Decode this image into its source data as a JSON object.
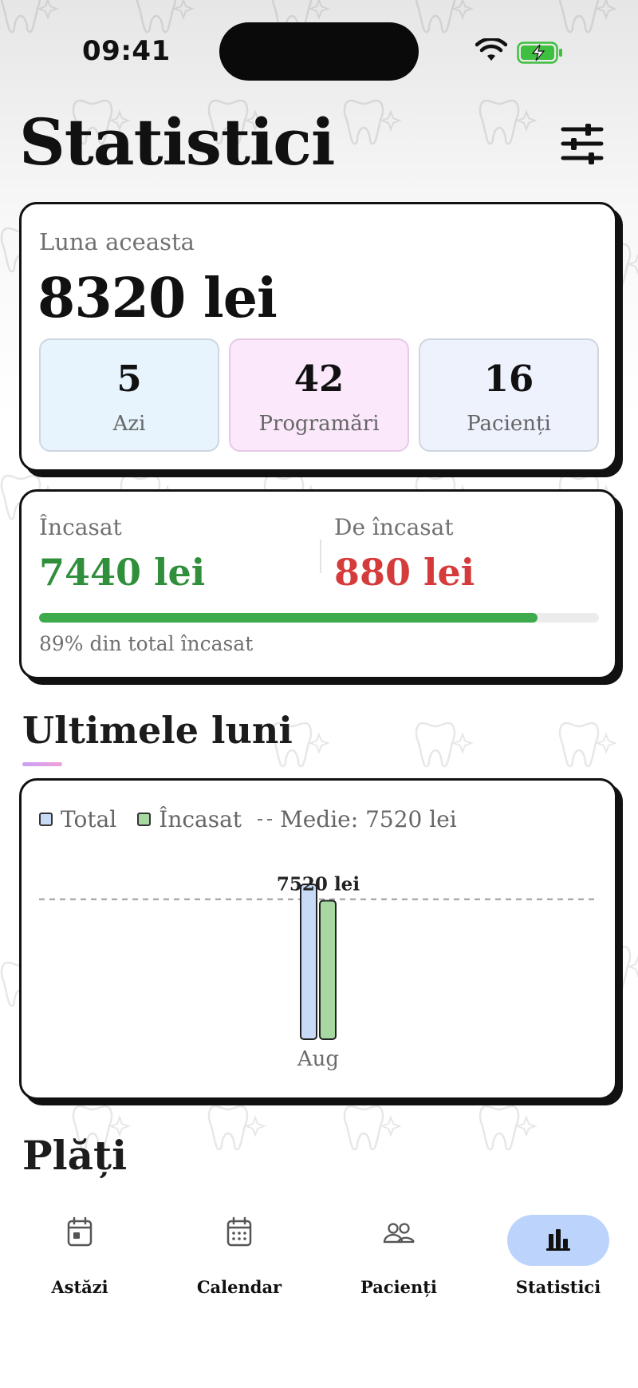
{
  "status_bar": {
    "time": "09:41"
  },
  "header": {
    "title": "Statistici",
    "filter_icon": "sliders-icon"
  },
  "month_card": {
    "label": "Luna aceasta",
    "total": "8320 lei",
    "tiles": [
      {
        "value": "5",
        "label": "Azi"
      },
      {
        "value": "42",
        "label": "Programări"
      },
      {
        "value": "16",
        "label": "Pacienți"
      }
    ]
  },
  "payments_card": {
    "paid_label": "Încasat",
    "paid_value": "7440 lei",
    "due_label": "De încasat",
    "due_value": "880 lei",
    "progress_percent": 89,
    "caption": "89% din total încasat"
  },
  "recent_months": {
    "title": "Ultimele luni",
    "legend": {
      "total": "Total",
      "paid": "Încasat",
      "average": "Medie: 7520 lei"
    }
  },
  "chart_data": {
    "type": "bar",
    "categories": [
      "Aug"
    ],
    "series": [
      {
        "name": "Total",
        "values": [
          8320
        ],
        "color": "#c7dbf7"
      },
      {
        "name": "Încasat",
        "values": [
          7440
        ],
        "color": "#a7d8a1"
      }
    ],
    "reference_line": {
      "value": 7520,
      "label": "7520 lei",
      "style": "dashed"
    },
    "ylim": [
      0,
      8320
    ],
    "legend_position": "top-left",
    "grid": false
  },
  "payments_section": {
    "title": "Plăți"
  },
  "tabbar": {
    "tabs": [
      {
        "label": "Astăzi",
        "icon": "calendar-day-icon",
        "active": false
      },
      {
        "label": "Calendar",
        "icon": "calendar-icon",
        "active": false
      },
      {
        "label": "Pacienți",
        "icon": "people-icon",
        "active": false
      },
      {
        "label": "Statistici",
        "icon": "bar-chart-icon",
        "active": true
      }
    ]
  },
  "colors": {
    "paid": "#2f8f3a",
    "due": "#d63b3b",
    "progress": "#3daa4b",
    "active_tab": "#bcd4fb"
  }
}
